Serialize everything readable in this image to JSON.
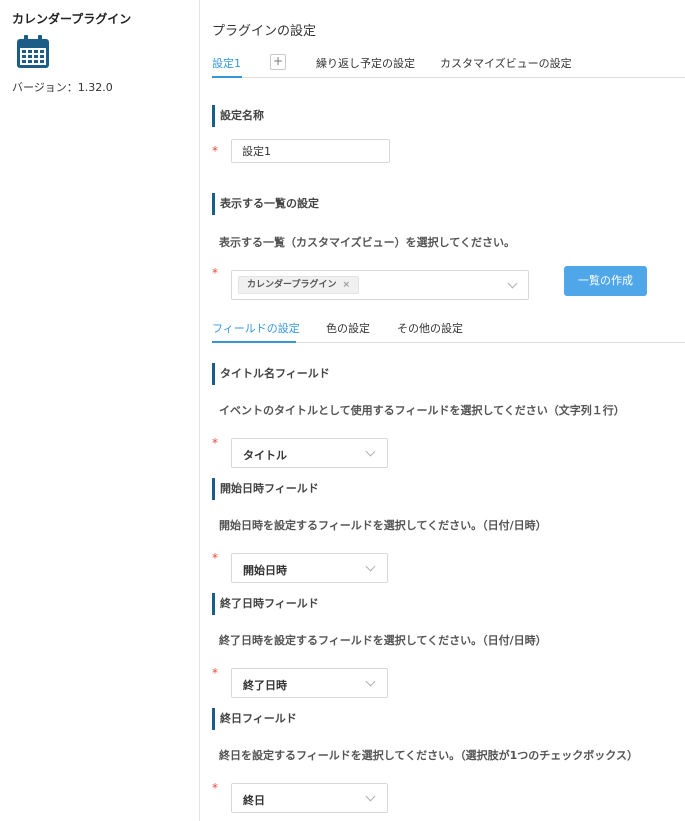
{
  "sidebar": {
    "plugin_name": "カレンダープラグイン",
    "icon": "calendar-icon",
    "version": "バージョン：1.32.0"
  },
  "page_title": "プラグインの設定",
  "top_tabs": [
    {
      "label": "設定1",
      "active": true
    },
    {
      "label": "繰り返し予定の設定",
      "active": false
    },
    {
      "label": "カスタマイズビューの設定",
      "active": false
    }
  ],
  "add_tab_label": "+",
  "setting_name": {
    "heading": "設定名称",
    "value": "設定1"
  },
  "list_setting": {
    "heading": "表示する一覧の設定",
    "description": "表示する一覧（カスタマイズビュー）を選択してください。",
    "selected_chip": "カレンダープラグイン",
    "chip_remove": "×",
    "create_button": "一覧の作成"
  },
  "sub_tabs": [
    {
      "label": "フィールドの設定",
      "active": true
    },
    {
      "label": "色の設定",
      "active": false
    },
    {
      "label": "その他の設定",
      "active": false
    }
  ],
  "fields": [
    {
      "heading": "タイトル名フィールド",
      "description": "イベントのタイトルとして使用するフィールドを選択してください（文字列１行）",
      "value": "タイトル"
    },
    {
      "heading": "開始日時フィールド",
      "description": "開始日時を設定するフィールドを選択してください。（日付/日時）",
      "value": "開始日時"
    },
    {
      "heading": "終了日時フィールド",
      "description": "終了日時を設定するフィールドを選択してください。（日付/日時）",
      "value": "終了日時"
    },
    {
      "heading": "終日フィールド",
      "description": "終日を設定するフィールドを選択してください。（選択肢が1つのチェックボックス）",
      "value": "終日"
    }
  ],
  "required_mark": "*",
  "colors": {
    "accent": "#3498db",
    "button": "#4fa7ea",
    "heading_bar": "#1c5d87",
    "required": "#e74c3c"
  }
}
